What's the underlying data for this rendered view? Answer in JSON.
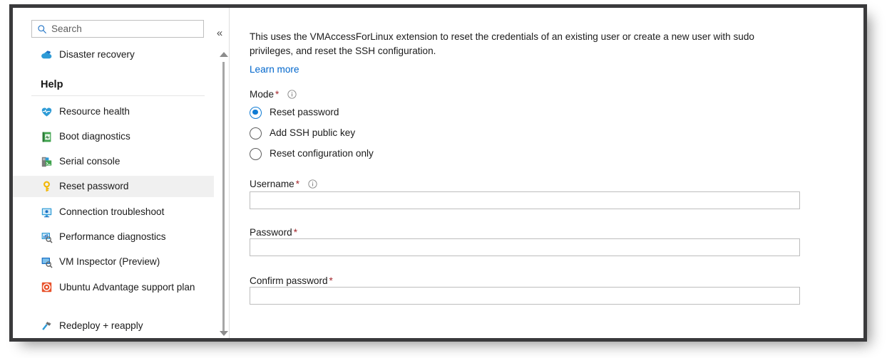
{
  "search": {
    "placeholder": "Search",
    "value": "",
    "icon": "search-icon"
  },
  "collapse": {
    "label": "«",
    "icon": "chevron-double-left-icon"
  },
  "sidebar": {
    "top_items": [
      {
        "label": "Disaster recovery",
        "icon": "disaster-recovery-cloud-icon",
        "selected": false
      }
    ],
    "section_title": "Help",
    "items": [
      {
        "label": "Resource health",
        "icon": "resource-health-heart-icon",
        "selected": false
      },
      {
        "label": "Boot diagnostics",
        "icon": "boot-diagnostics-icon",
        "selected": false
      },
      {
        "label": "Serial console",
        "icon": "serial-console-icon",
        "selected": false
      },
      {
        "label": "Reset password",
        "icon": "key-icon",
        "selected": true
      },
      {
        "label": "Connection troubleshoot",
        "icon": "connection-troubleshoot-monitor-icon",
        "selected": false
      },
      {
        "label": "Performance diagnostics",
        "icon": "performance-diagnostics-icon",
        "selected": false
      },
      {
        "label": "VM Inspector (Preview)",
        "icon": "vm-inspector-icon",
        "selected": false
      },
      {
        "label": "Ubuntu Advantage support plan",
        "icon": "ubuntu-circle-icon",
        "selected": false
      },
      {
        "label": "Redeploy + reapply",
        "icon": "hammer-icon",
        "selected": false
      }
    ]
  },
  "scrollbar": {
    "up_arrow": "scroll-up-arrow",
    "down_arrow": "scroll-down-arrow"
  },
  "main": {
    "description": "This uses the VMAccessForLinux extension to reset the credentials of an existing user or create a new user with sudo privileges, and reset the SSH configuration.",
    "learn_more": "Learn more",
    "mode": {
      "label": "Mode",
      "required_marker": "*",
      "info_icon": "info-icon",
      "options": [
        {
          "label": "Reset password",
          "selected": true
        },
        {
          "label": "Add SSH public key",
          "selected": false
        },
        {
          "label": "Reset configuration only",
          "selected": false
        }
      ]
    },
    "username": {
      "label": "Username",
      "required_marker": "*",
      "info_icon": "info-icon",
      "value": "",
      "placeholder": ""
    },
    "password": {
      "label": "Password",
      "required_marker": "*",
      "value": "",
      "placeholder": ""
    },
    "confirm_password": {
      "label": "Confirm password",
      "required_marker": "*",
      "value": "",
      "placeholder": ""
    }
  },
  "colors": {
    "accent": "#0f7bd4",
    "link": "#0066cc",
    "required": "#a4262c",
    "selection_bg": "#f0f0f0",
    "frame": "#3a3a3c"
  }
}
